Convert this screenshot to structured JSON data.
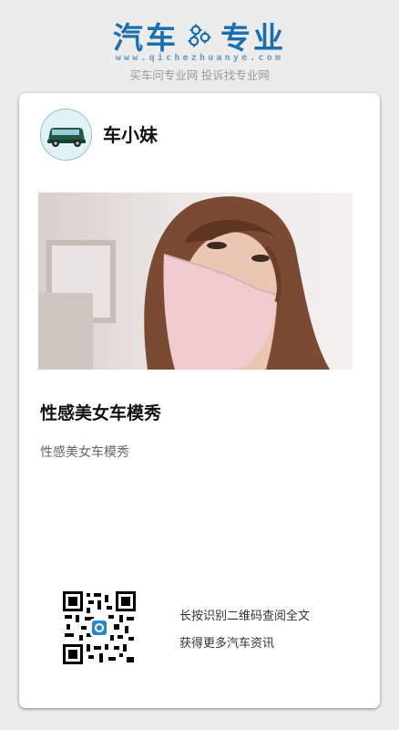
{
  "header": {
    "logo_left": "汽车",
    "logo_right": "专业",
    "domain": "www.qichezhuanye.com",
    "slogan": "买车问专业网 投诉找专业网",
    "brand_color": "#1b6fae"
  },
  "card": {
    "author": "车小妹",
    "title": "性感美女车模秀",
    "subtitle": "性感美女车模秀",
    "qr_line_1": "长按识别二维码查阅全文",
    "qr_line_2": "获得更多汽车资讯"
  }
}
